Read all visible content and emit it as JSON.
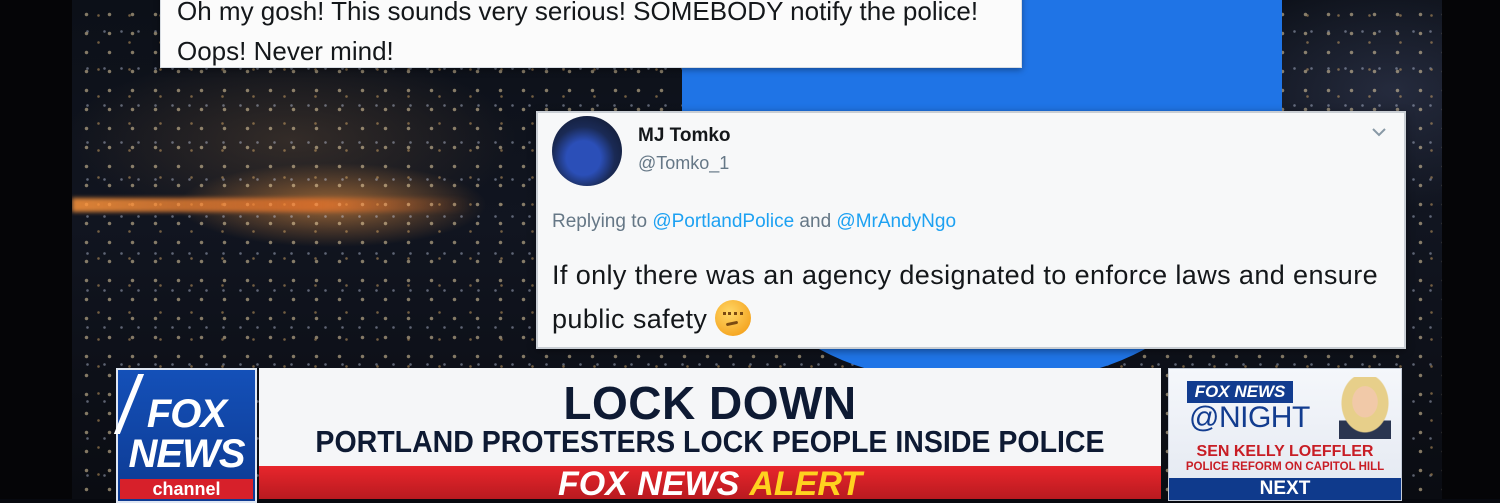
{
  "top_tweet": {
    "text": "Oh my gosh! This sounds very serious! SOMEBODY notify the police! Oops! Never mind!"
  },
  "main_tweet": {
    "display_name": "MJ Tomko",
    "handle": "@Tomko_1",
    "reply_prefix": "Replying to ",
    "reply_mention_1": "@PortlandPolice",
    "reply_and": " and ",
    "reply_mention_2": "@MrAndyNgo",
    "body": "If only there was an agency designated to enforce laws and ensure public safety",
    "emoji": "thinking-face-icon"
  },
  "lower_third": {
    "logo_fox": "FOX",
    "logo_news": "NEWS",
    "logo_channel": "channel",
    "headline": "LOCK DOWN",
    "subheadline": "PORTLAND PROTESTERS LOCK PEOPLE INSIDE POLICE PRECINCT",
    "alert_fox": "FOX NEWS",
    "alert_word": "ALERT"
  },
  "promo": {
    "brand": "FOX NEWS",
    "show": "@NIGHT",
    "guest": "SEN KELLY LOEFFLER",
    "topic": "POLICE REFORM ON CAPITOL HILL",
    "next_label": "NEXT"
  },
  "colors": {
    "twitter_blue": "#1f74e6",
    "fox_blue": "#0d3a92",
    "alert_red": "#d7202a",
    "alert_yellow": "#ffd21f",
    "mention_blue": "#1da1f2"
  }
}
